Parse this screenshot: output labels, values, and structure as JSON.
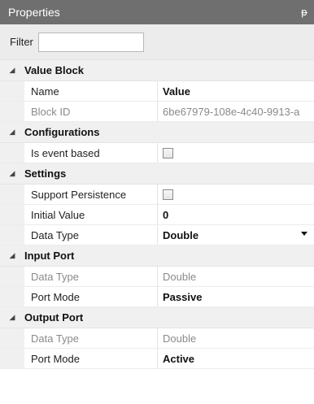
{
  "panel": {
    "title": "Properties",
    "pin_glyph": "ᵽ"
  },
  "filter": {
    "label": "Filter",
    "value": "",
    "placeholder": ""
  },
  "categories": [
    {
      "title": "Value Block",
      "rows": [
        {
          "name": "Name",
          "value": "Value"
        },
        {
          "name": "Block ID",
          "value": "6be67979-108e-4c40-9913-a"
        }
      ]
    },
    {
      "title": "Configurations",
      "rows": [
        {
          "name": "Is event based",
          "checked": false
        }
      ]
    },
    {
      "title": "Settings",
      "rows": [
        {
          "name": "Support Persistence",
          "checked": false
        },
        {
          "name": "Initial Value",
          "value": "0"
        },
        {
          "name": "Data Type",
          "value": "Double"
        }
      ]
    },
    {
      "title": "Input Port",
      "rows": [
        {
          "name": "Data Type",
          "value": "Double"
        },
        {
          "name": "Port Mode",
          "value": "Passive"
        }
      ]
    },
    {
      "title": "Output Port",
      "rows": [
        {
          "name": "Data Type",
          "value": "Double"
        },
        {
          "name": "Port Mode",
          "value": "Active"
        }
      ]
    }
  ],
  "icons": {
    "collapse": "chevron-expanded-icon",
    "dropdown": "dropdown-arrow-icon",
    "pin": "pin-icon"
  },
  "colors": {
    "titlebar": "#6f6f6f",
    "category_bg": "#f0f0f0",
    "readonly_text": "#8a8a8a"
  }
}
